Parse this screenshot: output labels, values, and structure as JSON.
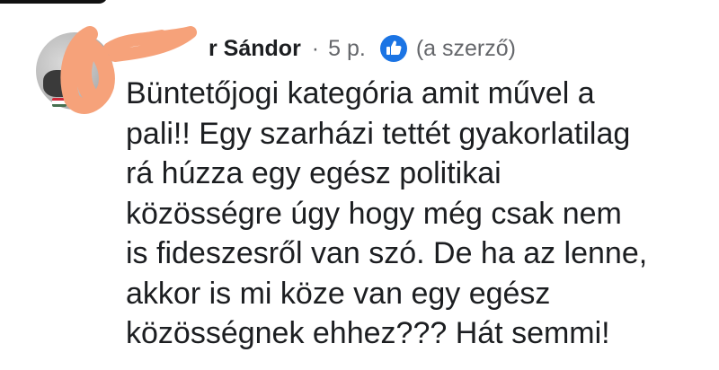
{
  "comment": {
    "author_name_visible": "r Sándor",
    "separator": "·",
    "time": "5 p.",
    "badge_icon": "thumbs-up-icon",
    "author_tag": "(a szerző)",
    "text_lines": [
      "Büntetőjogi kategória amit művel a",
      "pali!! Egy szarházi tettét gyakorlatilag",
      "rá húzza egy egész politikai",
      "közösségre úgy hogy még csak nem",
      "is fideszesről van szó. De ha az lenne,",
      "akkor is mi köze van egy egész",
      "közösségnek ehhez??? Hát semmi!"
    ]
  },
  "colors": {
    "text": "#1c1e21",
    "meta": "#65676b",
    "badge": "#1b74e4",
    "redaction": "#f6a27a"
  }
}
